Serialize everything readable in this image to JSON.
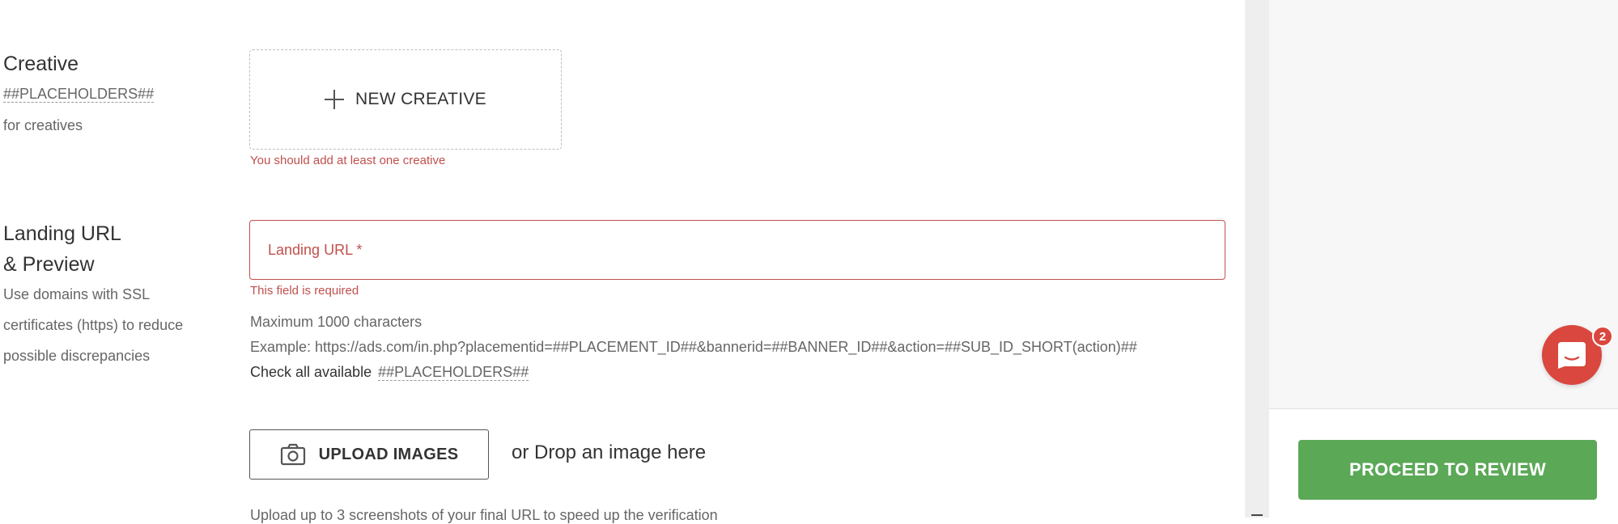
{
  "creative": {
    "title": "Creative",
    "placeholders_link": "##PLACEHOLDERS##",
    "subtitle": "for creatives",
    "new_creative_label": "NEW CREATIVE",
    "error": "You should add at least one creative"
  },
  "landing": {
    "title_line1": "Landing URL",
    "title_line2": "& Preview",
    "desc_line1": "Use domains with SSL",
    "desc_line2": "certificates (https) to reduce",
    "desc_line3": "possible discrepancies",
    "input_placeholder": "Landing URL *",
    "error": "This field is required",
    "max_chars": "Maximum 1000 characters",
    "example": "Example: https://ads.com/in.php?placementid=##PLACEMENT_ID##&bannerid=##BANNER_ID##&action=##SUB_ID_SHORT(action)##",
    "check_prefix": "Check all available",
    "placeholders_link": "##PLACEHOLDERS##"
  },
  "upload": {
    "button_label": "UPLOAD IMAGES",
    "drop_text": "or Drop an image here",
    "hint_cut": "Upload up to 3 screenshots of your final URL to speed up the verification"
  },
  "sidebar": {
    "proceed_label": "PROCEED TO REVIEW"
  },
  "chat": {
    "badge_count": "2"
  },
  "colors": {
    "error": "#c0504d",
    "primary_green": "#5ba857",
    "chat_red": "#d9473f"
  },
  "icons": {
    "new_creative": "plus-icon",
    "upload": "camera-icon",
    "chat": "chat-icon"
  }
}
